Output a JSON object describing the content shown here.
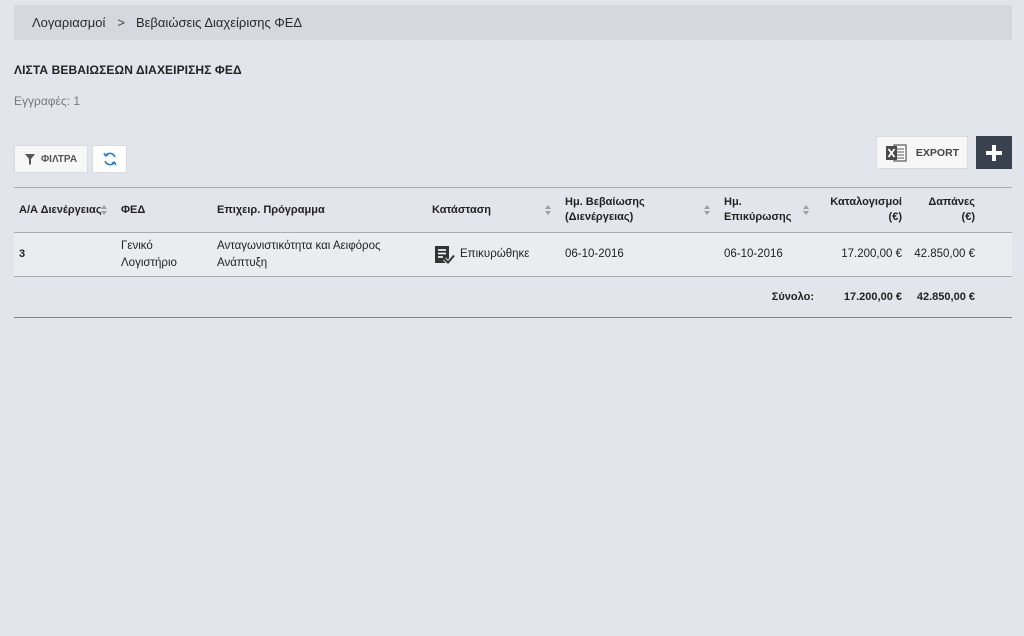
{
  "breadcrumb": {
    "items": [
      "Λογαριασμοί",
      "Βεβαιώσεις Διαχείρισης ΦΕΔ"
    ],
    "separator": ">"
  },
  "page": {
    "title": "ΛΙΣΤΑ ΒΕΒΑΙΩΣΕΩΝ ΔΙΑΧΕΙΡΙΣΗΣ ΦΕΔ",
    "records_label": "Εγγραφές: 1"
  },
  "toolbar": {
    "filters_label": "ΦΙΛΤΡΑ",
    "export_label": "EXPORT",
    "icons": {
      "filters": "filter-icon",
      "refresh": "refresh-icon",
      "export": "excel-icon",
      "add": "plus-icon"
    }
  },
  "table": {
    "columns": [
      "Α/Α Διενέργειας",
      "ΦΕΔ",
      "Επιχειρ. Πρόγραμμα",
      "Κατάσταση",
      "Ημ. Βεβαίωσης (Διενέργειας)",
      "Ημ. Επικύρωσης",
      "Καταλογισμοί (€)",
      "Δαπάνες (€)"
    ],
    "rows": [
      {
        "aa": "3",
        "fed": "Γενικό Λογιστήριο",
        "program": "Ανταγωνιστικότητα και Αειφόρος Ανάπτυξη",
        "status": "Επικυρώθηκε",
        "status_icon": "validated-document-icon",
        "date_confirmation": "06-10-2016",
        "date_validation": "06-10-2016",
        "charges": "17.200,00 €",
        "expenses": "42.850,00 €"
      }
    ],
    "totals": {
      "label": "Σύνολο:",
      "charges": "17.200,00 €",
      "expenses": "42.850,00 €"
    }
  },
  "colors": {
    "background": "#e3e5ec",
    "breadcrumb_bg": "#d5d8df",
    "add_button_bg": "#38414d"
  }
}
